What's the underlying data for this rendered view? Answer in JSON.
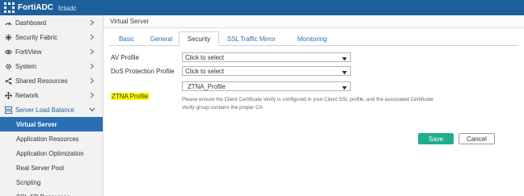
{
  "header": {
    "app_name": "FortiADC",
    "hostname": "fctadc"
  },
  "sidebar": {
    "items": [
      {
        "label": "Dashboard",
        "icon": "dashboard-icon"
      },
      {
        "label": "Security Fabric",
        "icon": "fabric-icon"
      },
      {
        "label": "FortiView",
        "icon": "view-icon"
      },
      {
        "label": "System",
        "icon": "gear-icon"
      },
      {
        "label": "Shared Resources",
        "icon": "share-icon"
      },
      {
        "label": "Network",
        "icon": "network-icon"
      },
      {
        "label": "Server Load Balance",
        "icon": "balance-icon"
      }
    ],
    "sub_items": [
      {
        "label": "Virtual Server",
        "active": true
      },
      {
        "label": "Application Resources"
      },
      {
        "label": "Application Optimization"
      },
      {
        "label": "Real Server Pool"
      },
      {
        "label": "Scripting"
      },
      {
        "label": "SSL-FP Resources"
      }
    ]
  },
  "main": {
    "panel_title": "Virtual Server",
    "tabs": [
      {
        "label": "Basic"
      },
      {
        "label": "General"
      },
      {
        "label": "Security",
        "active": true
      },
      {
        "label": "SSL Traffic Mirror"
      },
      {
        "label": "Monitoring"
      }
    ],
    "fields": {
      "av_profile": {
        "label": "AV Profile",
        "value": "Click to select"
      },
      "dos_profile": {
        "label": "DoS Protection Profile",
        "value": "Click to select"
      },
      "ztna_profile": {
        "label": "ZTNA Profile",
        "value": "ZTNA_Profile"
      }
    },
    "help_text": "Please ensure the Client Certificate Verify is configured in your Client SSL profile, and the associated Certificate Verify group contains the proper CA",
    "save_label": "Save",
    "cancel_label": "Cancel"
  },
  "colors": {
    "header_bg": "#1e5f9b",
    "active_nav": "#2a6fb0",
    "save_button": "#1fae8c",
    "highlight": "#ffff00"
  }
}
